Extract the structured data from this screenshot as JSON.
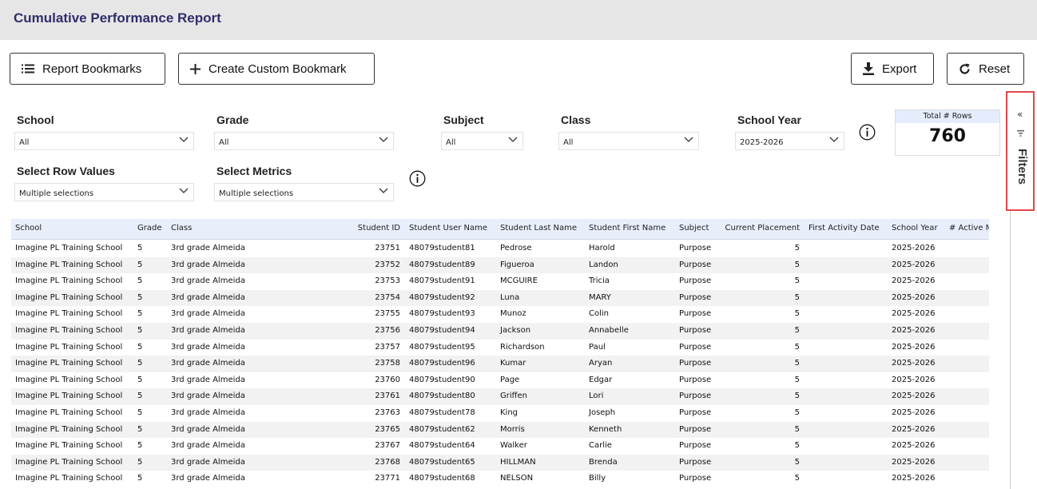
{
  "app": {
    "title": "Cumulative Performance Report"
  },
  "toolbar": {
    "report_bookmarks": "Report Bookmarks",
    "create_custom_bookmark": "Create Custom Bookmark",
    "export": "Export",
    "reset": "Reset"
  },
  "icons": {
    "bookmarks": "list-icon",
    "create": "plus-icon",
    "export": "download-icon",
    "reset": "refresh-icon",
    "info": "info-icon",
    "collapse": "double-chevron-left-icon",
    "funnel": "filter-icon"
  },
  "filters": {
    "school": {
      "label": "School",
      "value": "All"
    },
    "grade": {
      "label": "Grade",
      "value": "All"
    },
    "subject": {
      "label": "Subject",
      "value": "All"
    },
    "class": {
      "label": "Class",
      "value": "All"
    },
    "school_year": {
      "label": "School Year",
      "value": "2025-2026"
    },
    "row_values": {
      "label": "Select Row Values",
      "value": "Multiple selections"
    },
    "metrics": {
      "label": "Select Metrics",
      "value": "Multiple selections"
    }
  },
  "summary_card": {
    "label": "Total # Rows",
    "value": "760"
  },
  "filters_pane": {
    "label": "Filters",
    "collapse_glyph": "«"
  },
  "table": {
    "columns": [
      "School",
      "Grade",
      "Class",
      "Student ID",
      "Student User Name",
      "Student Last Name",
      "Student First Name",
      "Subject",
      "Current Placement",
      "First Activity Date",
      "School Year",
      "# Active M"
    ],
    "rows": [
      [
        "Imagine PL Training School",
        "5",
        "3rd grade Almeida",
        "23751",
        "48079student81",
        "Pedrose",
        "Harold",
        "Purpose",
        "5",
        "",
        "2025-2026"
      ],
      [
        "Imagine PL Training School",
        "5",
        "3rd grade Almeida",
        "23752",
        "48079student89",
        "Figueroa",
        "Landon",
        "Purpose",
        "5",
        "",
        "2025-2026"
      ],
      [
        "Imagine PL Training School",
        "5",
        "3rd grade Almeida",
        "23753",
        "48079student91",
        "MCGUIRE",
        "Tricia",
        "Purpose",
        "5",
        "",
        "2025-2026"
      ],
      [
        "Imagine PL Training School",
        "5",
        "3rd grade Almeida",
        "23754",
        "48079student92",
        "Luna",
        "MARY",
        "Purpose",
        "5",
        "",
        "2025-2026"
      ],
      [
        "Imagine PL Training School",
        "5",
        "3rd grade Almeida",
        "23755",
        "48079student93",
        "Munoz",
        "Colin",
        "Purpose",
        "5",
        "",
        "2025-2026"
      ],
      [
        "Imagine PL Training School",
        "5",
        "3rd grade Almeida",
        "23756",
        "48079student94",
        "Jackson",
        "Annabelle",
        "Purpose",
        "5",
        "",
        "2025-2026"
      ],
      [
        "Imagine PL Training School",
        "5",
        "3rd grade Almeida",
        "23757",
        "48079student95",
        "Richardson",
        "Paul",
        "Purpose",
        "5",
        "",
        "2025-2026"
      ],
      [
        "Imagine PL Training School",
        "5",
        "3rd grade Almeida",
        "23758",
        "48079student96",
        "Kumar",
        "Aryan",
        "Purpose",
        "5",
        "",
        "2025-2026"
      ],
      [
        "Imagine PL Training School",
        "5",
        "3rd grade Almeida",
        "23760",
        "48079student90",
        "Page",
        "Edgar",
        "Purpose",
        "5",
        "",
        "2025-2026"
      ],
      [
        "Imagine PL Training School",
        "5",
        "3rd grade Almeida",
        "23761",
        "48079student80",
        "Griffen",
        "Lori",
        "Purpose",
        "5",
        "",
        "2025-2026"
      ],
      [
        "Imagine PL Training School",
        "5",
        "3rd grade Almeida",
        "23763",
        "48079student78",
        "King",
        "Joseph",
        "Purpose",
        "5",
        "",
        "2025-2026"
      ],
      [
        "Imagine PL Training School",
        "5",
        "3rd grade Almeida",
        "23765",
        "48079student62",
        "Morris",
        "Kenneth",
        "Purpose",
        "5",
        "",
        "2025-2026"
      ],
      [
        "Imagine PL Training School",
        "5",
        "3rd grade Almeida",
        "23767",
        "48079student64",
        "Walker",
        "Carlie",
        "Purpose",
        "5",
        "",
        "2025-2026"
      ],
      [
        "Imagine PL Training School",
        "5",
        "3rd grade Almeida",
        "23768",
        "48079student65",
        "HILLMAN",
        "Brenda",
        "Purpose",
        "5",
        "",
        "2025-2026"
      ],
      [
        "Imagine PL Training School",
        "5",
        "3rd grade Almeida",
        "23771",
        "48079student68",
        "NELSON",
        "Billy",
        "Purpose",
        "5",
        "",
        "2025-2026"
      ]
    ]
  }
}
